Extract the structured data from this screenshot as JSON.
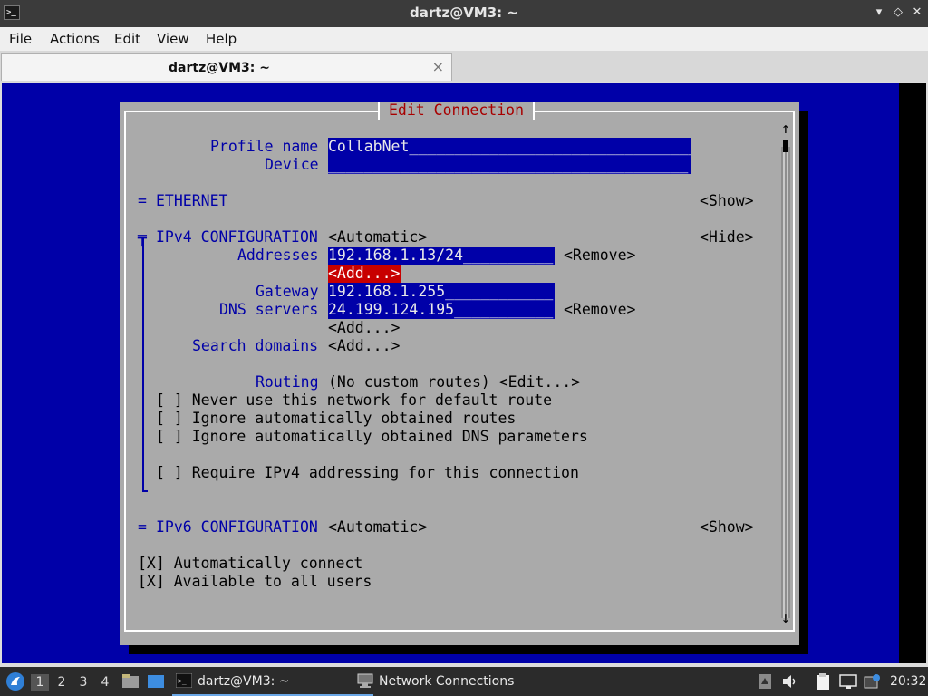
{
  "window": {
    "title": "dartz@VM3: ~",
    "app_icon": ">_"
  },
  "window_controls": {
    "minimize": "▾",
    "restore": "◇",
    "close": "✕"
  },
  "menu": [
    "File",
    "Actions",
    "Edit",
    "View",
    "Help"
  ],
  "tab": {
    "label": "dartz@VM3: ~",
    "close": "×"
  },
  "dialog": {
    "title": "Edit Connection",
    "profile_name_label": "Profile name",
    "profile_name_value": "CollabNet",
    "device_label": "Device",
    "device_value": "",
    "ethernet": {
      "marker": "=",
      "label": "ETHERNET",
      "toggle": "<Show>"
    },
    "ipv4": {
      "marker": "╤",
      "label": "IPv4 CONFIGURATION",
      "mode": "<Automatic>",
      "toggle": "<Hide>",
      "addresses_label": "Addresses",
      "address_value": "192.168.1.13/24",
      "remove1": "<Remove>",
      "add_selected": "<Add...>",
      "gateway_label": "Gateway",
      "gateway_value": "192.168.1.255",
      "dns_label": "DNS servers",
      "dns_value": "24.199.124.195",
      "remove2": "<Remove>",
      "add_dns": "<Add...>",
      "search_label": "Search domains",
      "add_search": "<Add...>",
      "routing_label": "Routing",
      "routing_value": "(No custom routes) <Edit...>",
      "cb1": "[ ] Never use this network for default route",
      "cb2": "[ ] Ignore automatically obtained routes",
      "cb3": "[ ] Ignore automatically obtained DNS parameters",
      "cb4": "[ ] Require IPv4 addressing for this connection"
    },
    "ipv6": {
      "marker": "=",
      "label": "IPv6 CONFIGURATION",
      "mode": "<Automatic>",
      "toggle": "<Show>"
    },
    "auto_connect": "[X] Automatically connect",
    "all_users": "[X] Available to all users",
    "scroll_up": "↑",
    "scroll_down": "↓"
  },
  "taskbar": {
    "desktops": [
      "1",
      "2",
      "3",
      "4"
    ],
    "tasks": [
      {
        "label": "dartz@VM3: ~",
        "icon": "terminal-icon"
      },
      {
        "label": "Network Connections",
        "icon": "network-icon"
      }
    ],
    "clock": "20:32"
  },
  "colors": {
    "terminal_bg": "#0000a8",
    "dialog_bg": "#aaaaaa",
    "label": "#0000a8",
    "selected": "#c80000",
    "title": "#a80000"
  }
}
